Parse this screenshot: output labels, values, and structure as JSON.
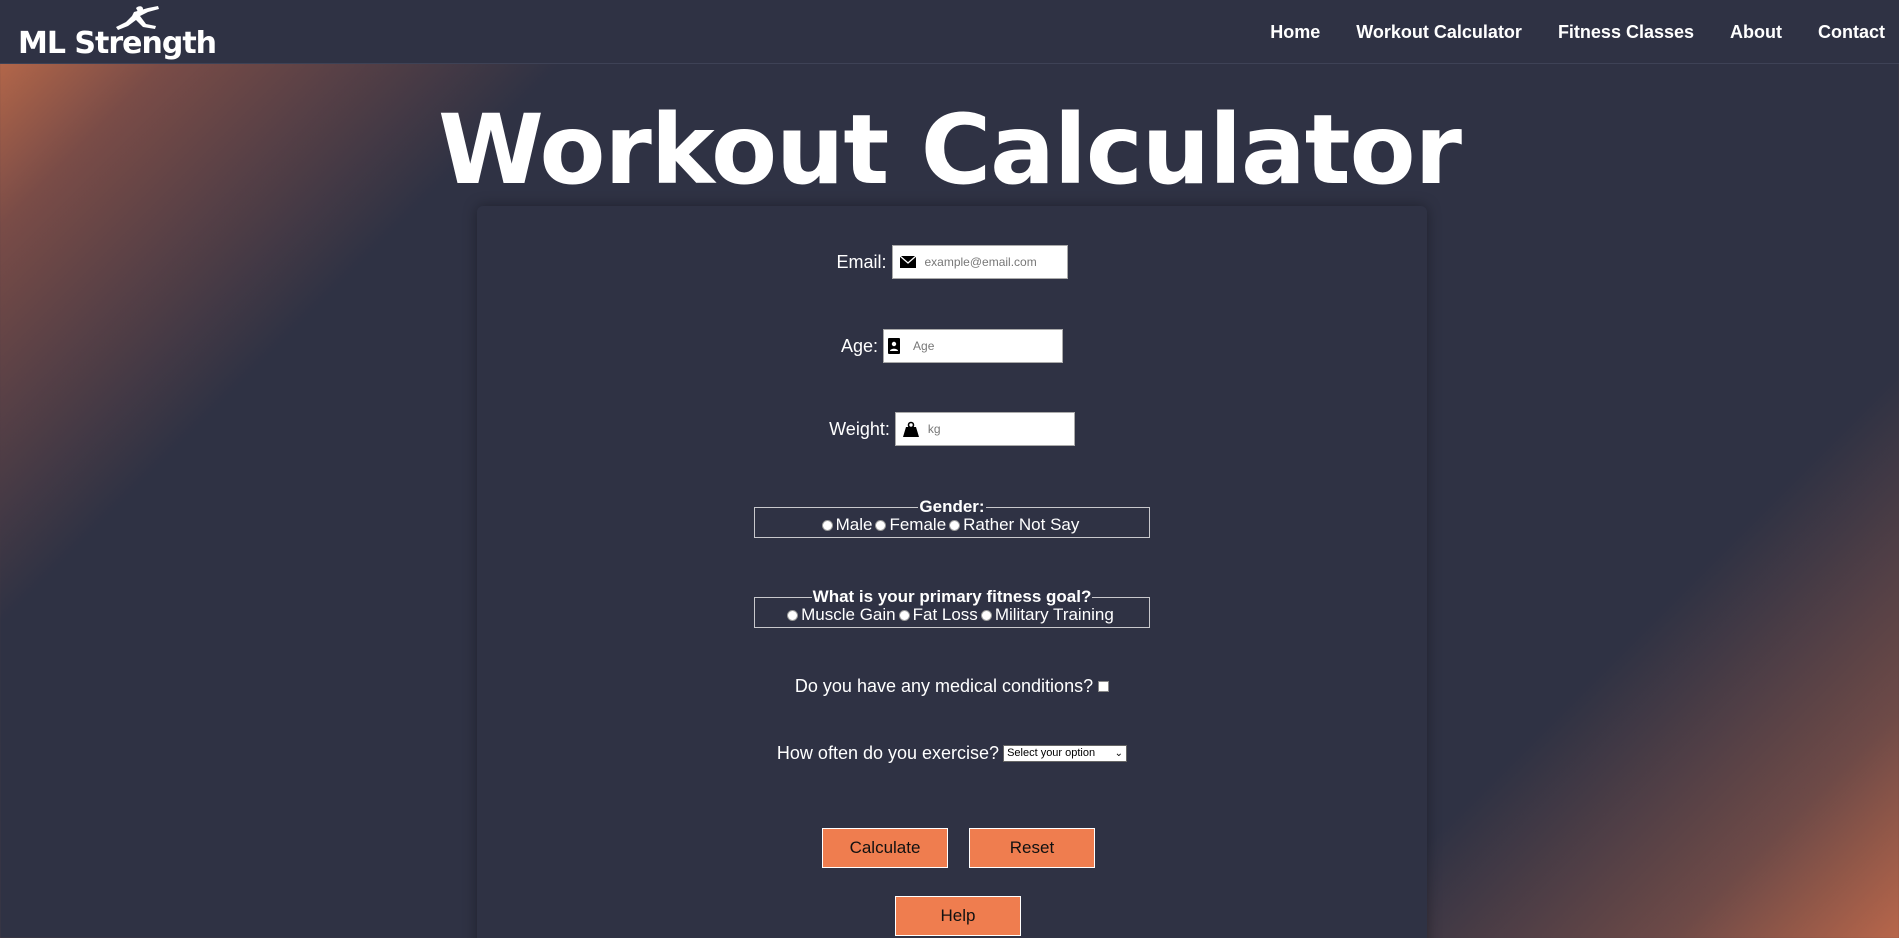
{
  "brand": {
    "logo_text": "ML Strength"
  },
  "nav": {
    "items": [
      "Home",
      "Workout Calculator",
      "Fitness Classes",
      "About",
      "Contact"
    ]
  },
  "page": {
    "title": "Workout Calculator"
  },
  "form": {
    "email": {
      "label": "Email:",
      "placeholder": "example@email.com",
      "icon": "envelope-icon"
    },
    "age": {
      "label": "Age:",
      "placeholder": "Age",
      "icon": "id-card-icon"
    },
    "weight": {
      "label": "Weight:",
      "placeholder": "kg",
      "icon": "weight-icon"
    },
    "gender": {
      "legend": "Gender:",
      "options": [
        "Male",
        "Female",
        "Rather Not Say"
      ]
    },
    "goal": {
      "legend": "What is your primary fitness goal?",
      "options": [
        "Muscle Gain",
        "Fat Loss",
        "Military Training"
      ]
    },
    "medical": {
      "label": "Do you have any medical conditions?"
    },
    "frequency": {
      "label": "How often do you exercise?",
      "selected": "Select your option"
    },
    "buttons": {
      "calculate": "Calculate",
      "reset": "Reset",
      "help": "Help"
    }
  },
  "colors": {
    "background": "#2f3244",
    "accent": "#ef7d4f",
    "gradient_corner": "#c8704a"
  }
}
